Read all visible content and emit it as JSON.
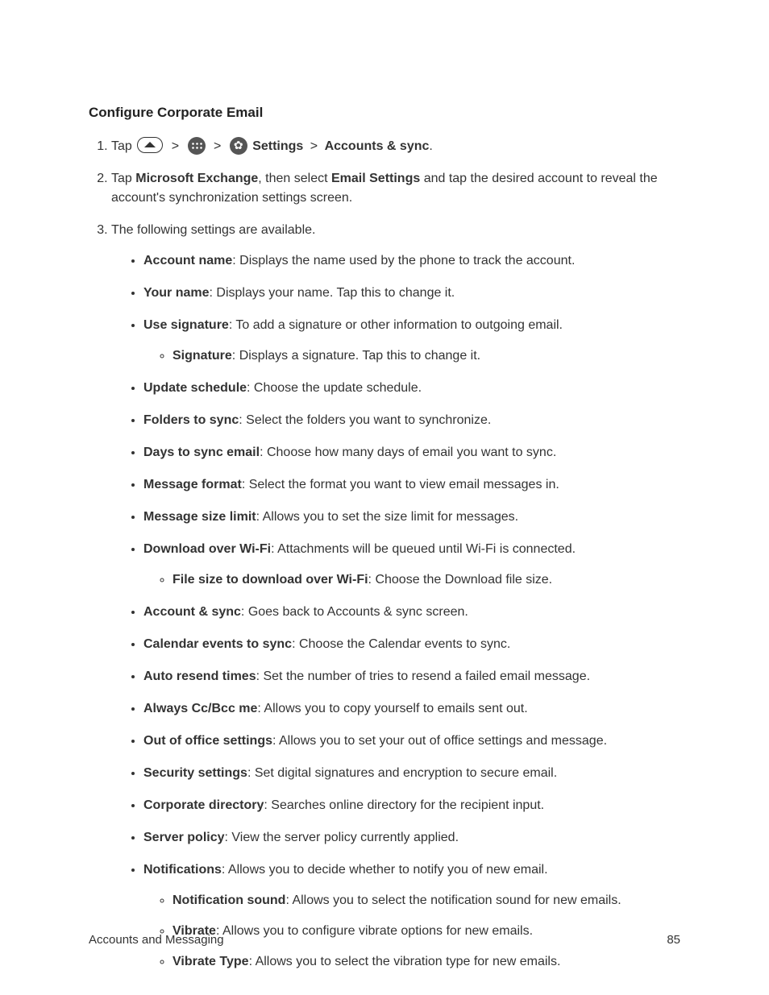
{
  "heading": "Configure Corporate Email",
  "step1": {
    "prefix": "Tap",
    "gt": ">",
    "settings_label": "Settings",
    "accounts_label": "Accounts & sync",
    "period": "."
  },
  "step2": {
    "t1": "Tap ",
    "b1": "Microsoft Exchange",
    "t2": ", then select ",
    "b2": "Email Settings",
    "t3": " and tap the desired account to reveal the account's synchronization settings screen."
  },
  "step3": {
    "intro": "The following settings are available.",
    "items": [
      {
        "name": "Account name",
        "desc": ": Displays the name used by the phone to track the account."
      },
      {
        "name": "Your name",
        "desc": ": Displays your name. Tap this to change it."
      },
      {
        "name": "Use signature",
        "desc": ": To add a signature or other information to outgoing email.",
        "sub": [
          {
            "name": "Signature",
            "desc": ": Displays a signature. Tap this to change it."
          }
        ]
      },
      {
        "name": "Update schedule",
        "desc": ": Choose the update schedule."
      },
      {
        "name": "Folders to sync",
        "desc": ": Select the folders you want to synchronize."
      },
      {
        "name": "Days to sync email",
        "desc": ": Choose how many days of email you want to sync."
      },
      {
        "name": "Message format",
        "desc": ": Select the format you want to view email messages in."
      },
      {
        "name": "Message size limit",
        "desc": ": Allows you to set the size limit for messages."
      },
      {
        "name": "Download over Wi-Fi",
        "desc": ": Attachments will be queued until Wi-Fi is connected.",
        "sub": [
          {
            "name": "File size to download over Wi-Fi",
            "desc": ": Choose the Download file size."
          }
        ]
      },
      {
        "name": "Account & sync",
        "desc": ": Goes back to Accounts & sync screen."
      },
      {
        "name": "Calendar events to sync",
        "desc": ": Choose the Calendar events to sync."
      },
      {
        "name": "Auto resend times",
        "desc": ": Set the number of tries to resend a failed email message."
      },
      {
        "name": "Always Cc/Bcc me",
        "desc": ": Allows you to copy yourself to emails sent out."
      },
      {
        "name": "Out of office settings",
        "desc": ": Allows you to set your out of office settings and message."
      },
      {
        "name": "Security settings",
        "desc": ": Set digital signatures and encryption to secure email."
      },
      {
        "name": "Corporate directory",
        "desc": ": Searches online directory for the recipient input."
      },
      {
        "name": "Server policy",
        "desc": ": View the server policy currently applied."
      },
      {
        "name": "Notifications",
        "desc": ": Allows you to decide whether to notify you of new email.",
        "sub": [
          {
            "name": "Notification sound",
            "desc": ": Allows you to select the notification sound for new emails."
          },
          {
            "name": "Vibrate",
            "desc": ": Allows you to configure vibrate options for new emails."
          },
          {
            "name": "Vibrate Type",
            "desc": ": Allows you to select the vibration type for new emails."
          }
        ]
      }
    ]
  },
  "footer": {
    "section": "Accounts and Messaging",
    "page": "85"
  }
}
